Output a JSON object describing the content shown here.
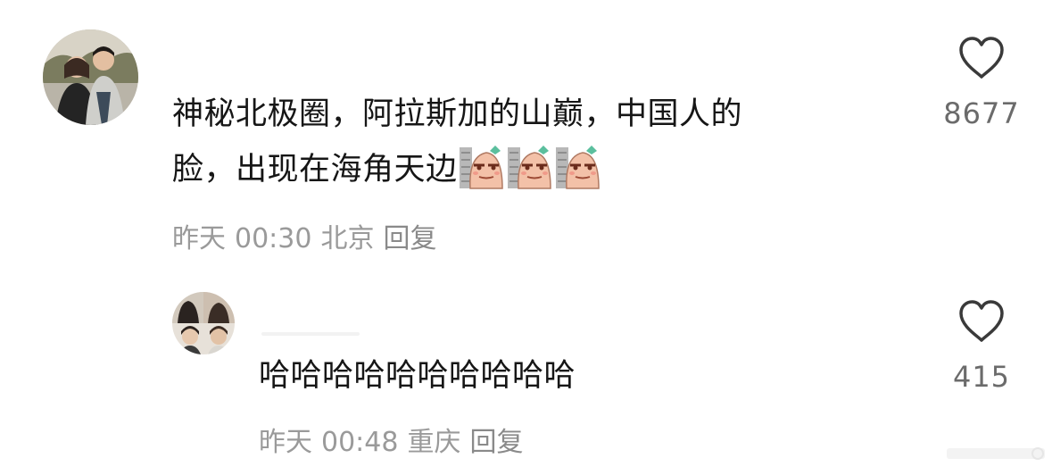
{
  "comments": [
    {
      "text_line1": "神秘北极圈，阿拉斯加的山巅，中国人的",
      "text_line2": "脸，出现在海角天边",
      "emoji": [
        "watching-emoji",
        "watching-emoji",
        "watching-emoji"
      ],
      "meta": {
        "day": "昨天",
        "time": "00:30",
        "location": "北京",
        "reply": "回复"
      },
      "likes": "8677"
    },
    {
      "text": "哈哈哈哈哈哈哈哈哈哈",
      "meta": {
        "day": "昨天",
        "time": "00:48",
        "location": "重庆",
        "reply": "回复"
      },
      "likes": "415"
    }
  ],
  "icons": {
    "like": "heart-outline-icon"
  },
  "colors": {
    "text": "#161616",
    "meta": "#9a9a9a",
    "like_count": "#6b6b6b",
    "heart_stroke": "#3a3a3a"
  }
}
